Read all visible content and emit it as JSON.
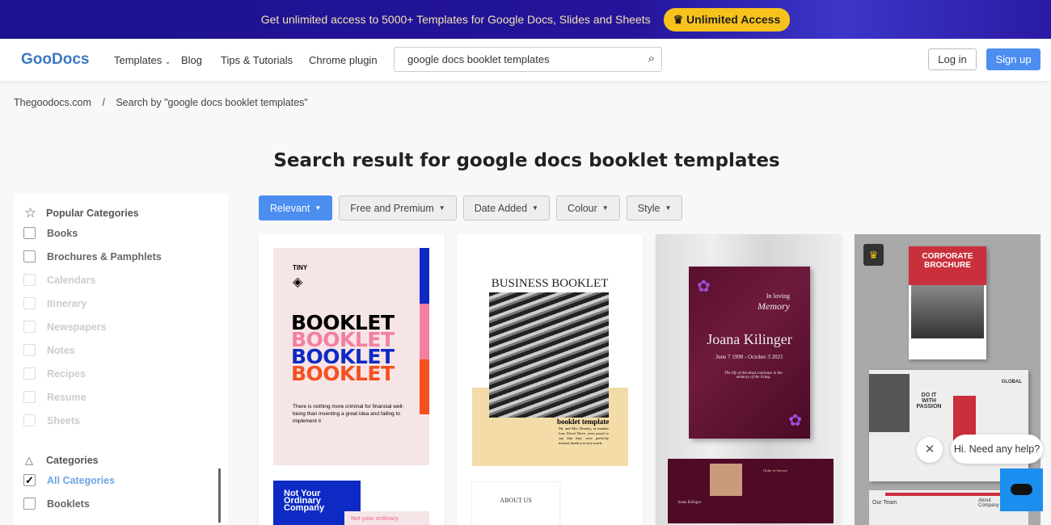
{
  "banner": {
    "text": "Get unlimited access to 5000+ Templates for Google Docs, Slides and Sheets",
    "cta": "Unlimited Access",
    "cta_icon": "crown-icon"
  },
  "nav": {
    "logo": "GooDocs",
    "links": [
      "Templates",
      "Blog",
      "Tips & Tutorials",
      "Chrome plugin"
    ],
    "search_value": "google docs booklet templates",
    "login": "Log in",
    "signup": "Sign up"
  },
  "breadcrumb": {
    "home": "Thegoodocs.com",
    "sep": "/",
    "current": "Search by \"google docs booklet templates\""
  },
  "title": "Search result for google docs booklet templates",
  "sidebar": {
    "popular_heading": "Popular Categories",
    "popular": [
      "Books",
      "Brochures & Pamphlets",
      "Calendars",
      "Itinerary",
      "Newspapers",
      "Notes",
      "Recipes",
      "Resume",
      "Sheets"
    ],
    "categories_heading": "Categories",
    "categories": [
      {
        "label": "All Categories",
        "checked": true
      },
      {
        "label": "Booklets",
        "checked": false
      }
    ]
  },
  "filters": [
    "Relevant",
    "Free and Premium",
    "Date Added",
    "Colour",
    "Style"
  ],
  "cards": {
    "c1": {
      "brand": "TINY",
      "word": "BOOKLET",
      "body": "There is nothing more criminal for financial well-being than inventing a great idea and failing to implement it",
      "page2": "Not Your Ordinary Company",
      "page2b": "Not your ordinary"
    },
    "c2": {
      "title": "BUSINESS BOOKLET",
      "sub": "booklet template",
      "body": "Mr. and Mrs. Dursley, of number four, Privet Drive, were proud to say that they were perfectly normal, thank you very much.",
      "page2": "ABOUT US"
    },
    "c3": {
      "a": "In loving",
      "b": "Memory",
      "name": "Joana Kilinger",
      "dates": "June 7 1990 - October 3 2021",
      "quote": "The life of the dead continues in the memory of the living.",
      "inner_name": "Joana Kilinger",
      "inner_title": "Order of Service"
    },
    "c4": {
      "title": "CORPORATE BROCHURE",
      "d": "DO IT WITH PASSION",
      "g": "GLOBAL",
      "team": "Our Team",
      "about": "About Company",
      "premium_icon": "crown-icon"
    }
  },
  "chat": {
    "text": "Hi. Need any help?"
  },
  "colors": {
    "accent": "#4b8ef0",
    "banner": "#1c1290",
    "cta": "#f7c21b"
  }
}
